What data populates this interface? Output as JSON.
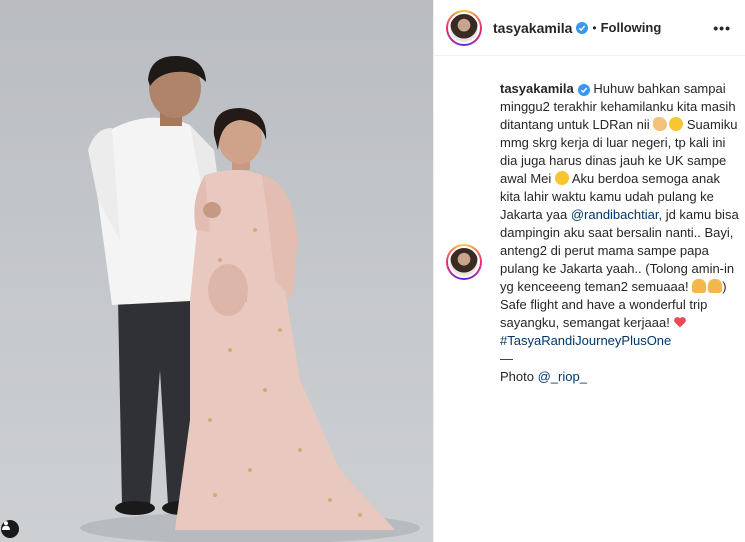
{
  "post": {
    "username": "tasyakamila",
    "follow_status": "Following",
    "separator": "•",
    "more_label": "•••"
  },
  "caption": {
    "username": "tasyakamila",
    "line1": "Huhuw bahkan sampai minggu2 terakhir kehamilanku kita masih ditantang untuk LDRan nii",
    "line2": "Suamiku mmg skrg kerja di luar negeri, tp kali ini dia juga harus dinas jauh ke UK sampe awal Mei",
    "line3": "Aku berdoa semoga anak kita lahir waktu kamu udah pulang ke Jakarta yaa",
    "mention": "@randibachtiar",
    "line4": ", jd kamu bisa dampingin aku saat bersalin nanti.. Bayi, anteng2 di perut mama sampe papa pulang ke Jakarta yaah.. (Tolong amin-in yg kenceeeng teman2 semuaaa!",
    "line4_end": ")",
    "line5": "Safe flight and have a wonderful trip sayangku, semangat kerjaaa!",
    "hashtag": "#TasyaRandiJourneyPlusOne",
    "dash": "—",
    "photo_credit_prefix": "Photo ",
    "photo_credit_handle": "@_riop_"
  },
  "icons": {
    "verified": "verified-badge-icon",
    "more": "more-options-icon",
    "tag": "user-tag-icon",
    "emojis": [
      "flexed-biceps-icon",
      "upside-down-face-icon",
      "grinning-squinting-face-icon",
      "folded-hands-icon",
      "red-heart-icon"
    ]
  },
  "colors": {
    "link": "#00376b",
    "verified": "#3897f0",
    "heart": "#ed4956"
  }
}
